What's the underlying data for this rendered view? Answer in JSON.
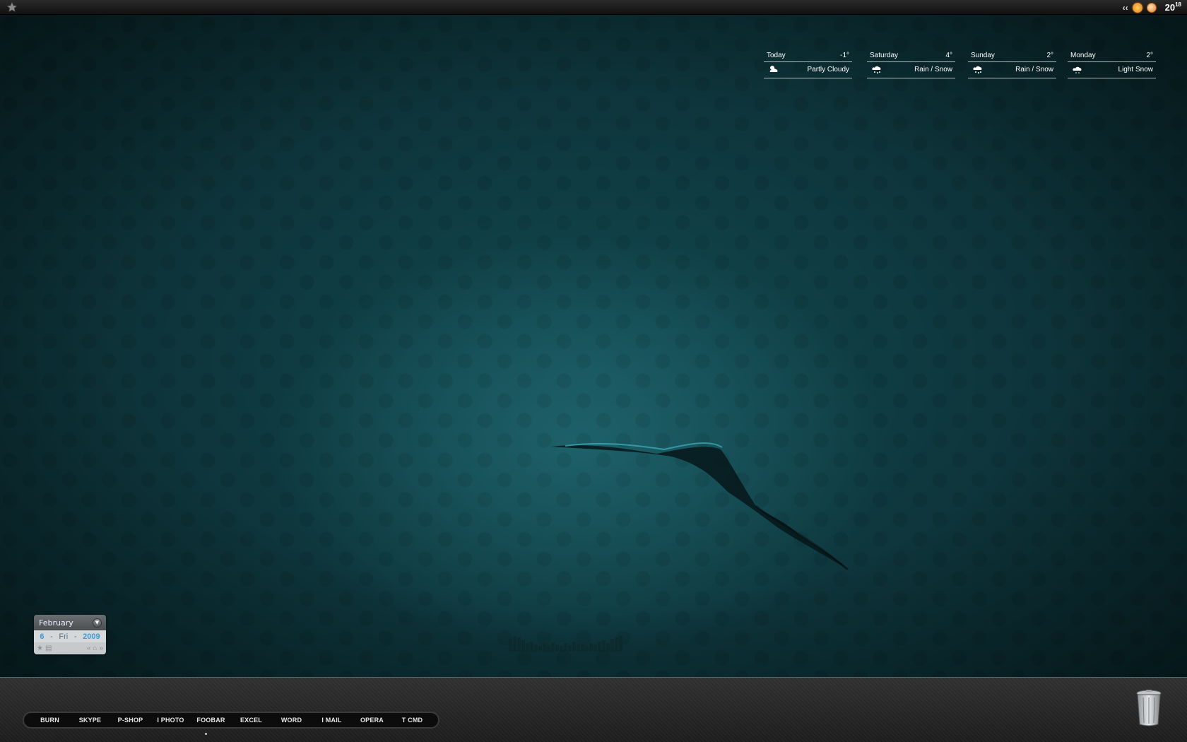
{
  "topbar": {
    "left_icon": "star-icon",
    "tray": {
      "collapse": "‹‹",
      "icons": [
        "weather-sun-icon",
        "avatar-face-icon"
      ],
      "clock_hour": "20",
      "clock_minute": "18"
    }
  },
  "weather": [
    {
      "day": "Today",
      "temp": "-1°",
      "condition": "Partly Cloudy",
      "icon": "partly-cloudy-icon"
    },
    {
      "day": "Saturday",
      "temp": "4°",
      "condition": "Rain / Snow",
      "icon": "rain-snow-icon"
    },
    {
      "day": "Sunday",
      "temp": "2°",
      "condition": "Rain / Snow",
      "icon": "rain-snow-icon"
    },
    {
      "day": "Monday",
      "temp": "2°",
      "condition": "Light Snow",
      "icon": "light-snow-icon"
    }
  ],
  "calendar": {
    "month": "February",
    "day": "6",
    "weekday": "Fri",
    "year": "2009",
    "separator": "-"
  },
  "dock": {
    "apps": [
      "BURN",
      "SKYPE",
      "P-SHOP",
      "I PHOTO",
      "FOOBAR",
      "EXCEL",
      "WORD",
      "I MAIL",
      "OPERA",
      "T CMD"
    ],
    "trash_icon": "trash-icon"
  },
  "colors": {
    "wallpaper": "#0d343a",
    "calendar_accent": "#3a9bd6",
    "dock": "#262626"
  }
}
